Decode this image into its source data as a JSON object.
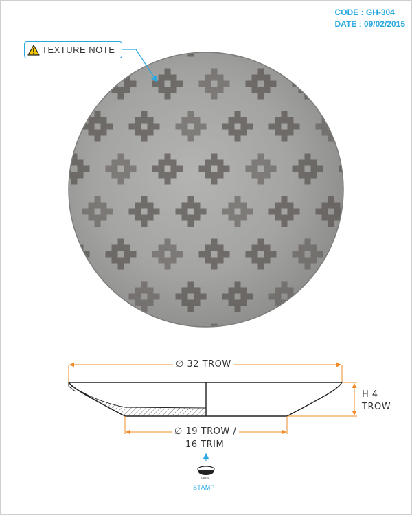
{
  "header": {
    "code": "CODE : GH-304",
    "date": "DATE : 09/02/2015"
  },
  "callout": {
    "label": "TEXTURE NOTE",
    "icon": "warning-icon"
  },
  "dimensions": {
    "outer_diameter": "∅ 32 TROW",
    "height_line1": "H 4",
    "height_line2": "TROW",
    "base_line1": "∅ 19 TROW /",
    "base_line2": "16 TRIM"
  },
  "stamp": {
    "brand": "gaya",
    "label": "STAMP"
  },
  "colors": {
    "accent": "#29a9e0",
    "dimension_orange": "#f28c28",
    "plate_grey": "#9a9a9a",
    "pattern_dark": "#5a5552"
  }
}
